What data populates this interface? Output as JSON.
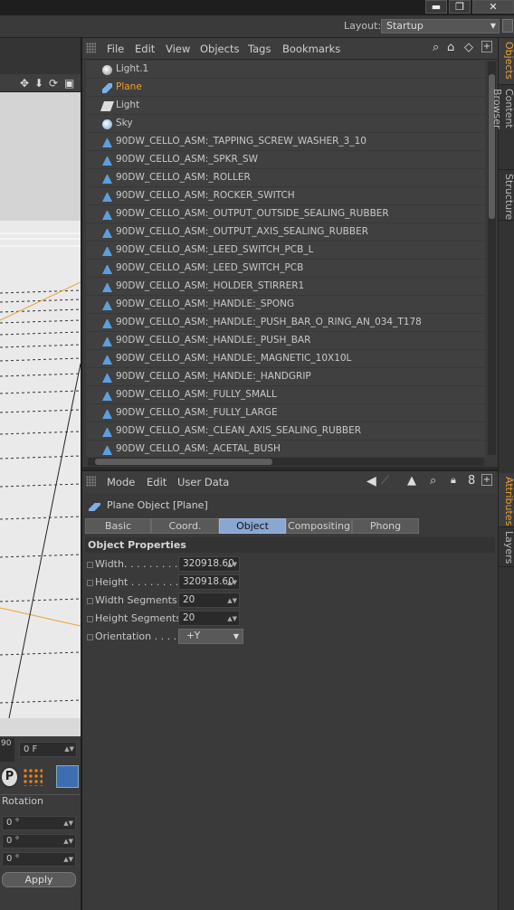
{
  "window": {
    "minimize": "▬",
    "restore": "❐",
    "close": "✕"
  },
  "layout": {
    "label": "Layout:",
    "value": "Startup"
  },
  "object_manager": {
    "menu": [
      "File",
      "Edit",
      "View",
      "Objects",
      "Tags",
      "Bookmarks"
    ],
    "objects": [
      {
        "name": "Light.1",
        "icon": "bulb-icon",
        "color": "#c9c9c9"
      },
      {
        "name": "Plane",
        "icon": "plane-icon",
        "color": "#f0a030"
      },
      {
        "name": "Light",
        "icon": "spotlight-icon",
        "color": "#c9c9c9"
      },
      {
        "name": "Sky",
        "icon": "sky-icon",
        "color": "#c9c9c9"
      },
      {
        "name": "90DW_CELLO_ASM:_TAPPING_SCREW_WASHER_3_10",
        "icon": "cone-icon",
        "color": "#c9c9c9"
      },
      {
        "name": "90DW_CELLO_ASM:_SPKR_SW",
        "icon": "cone-icon",
        "color": "#c9c9c9"
      },
      {
        "name": "90DW_CELLO_ASM:_ROLLER",
        "icon": "cone-icon",
        "color": "#c9c9c9"
      },
      {
        "name": "90DW_CELLO_ASM:_ROCKER_SWITCH",
        "icon": "cone-icon",
        "color": "#c9c9c9"
      },
      {
        "name": "90DW_CELLO_ASM:_OUTPUT_OUTSIDE_SEALING_RUBBER",
        "icon": "cone-icon",
        "color": "#c9c9c9"
      },
      {
        "name": "90DW_CELLO_ASM:_OUTPUT_AXIS_SEALING_RUBBER",
        "icon": "cone-icon",
        "color": "#c9c9c9"
      },
      {
        "name": "90DW_CELLO_ASM:_LEED_SWITCH_PCB_L",
        "icon": "cone-icon",
        "color": "#c9c9c9"
      },
      {
        "name": "90DW_CELLO_ASM:_LEED_SWITCH_PCB",
        "icon": "cone-icon",
        "color": "#c9c9c9"
      },
      {
        "name": "90DW_CELLO_ASM:_HOLDER_STIRRER1",
        "icon": "cone-icon",
        "color": "#c9c9c9"
      },
      {
        "name": "90DW_CELLO_ASM:_HANDLE:_SPONG",
        "icon": "cone-icon",
        "color": "#c9c9c9"
      },
      {
        "name": "90DW_CELLO_ASM:_HANDLE:_PUSH_BAR_O_RING_AN_034_T178",
        "icon": "cone-icon",
        "color": "#c9c9c9"
      },
      {
        "name": "90DW_CELLO_ASM:_HANDLE:_PUSH_BAR",
        "icon": "cone-icon",
        "color": "#c9c9c9"
      },
      {
        "name": "90DW_CELLO_ASM:_HANDLE:_MAGNETIC_10X10L",
        "icon": "cone-icon",
        "color": "#c9c9c9"
      },
      {
        "name": "90DW_CELLO_ASM:_HANDLE:_HANDGRIP",
        "icon": "cone-icon",
        "color": "#c9c9c9"
      },
      {
        "name": "90DW_CELLO_ASM:_FULLY_SMALL",
        "icon": "cone-icon",
        "color": "#c9c9c9"
      },
      {
        "name": "90DW_CELLO_ASM:_FULLY_LARGE",
        "icon": "cone-icon",
        "color": "#c9c9c9"
      },
      {
        "name": "90DW_CELLO_ASM:_CLEAN_AXIS_SEALING_RUBBER",
        "icon": "cone-icon",
        "color": "#c9c9c9"
      },
      {
        "name": "90DW_CELLO_ASM:_ACETAL_BUSH",
        "icon": "cone-icon",
        "color": "#c9c9c9"
      }
    ]
  },
  "attribute_manager": {
    "menu": [
      "Mode",
      "Edit",
      "User Data"
    ],
    "title": "Plane Object [Plane]",
    "tabs": [
      {
        "label": "Basic",
        "active": false
      },
      {
        "label": "Coord.",
        "active": false
      },
      {
        "label": "Object",
        "active": true
      },
      {
        "label": "Compositing",
        "active": false
      },
      {
        "label": "Phong",
        "active": false
      }
    ],
    "section": "Object Properties",
    "properties": [
      {
        "label": "Width. . . . . . . . . .",
        "value": "320918.60"
      },
      {
        "label": "Height . . . . . . . . .",
        "value": "320918.60"
      },
      {
        "label": "Width Segments",
        "value": "20"
      },
      {
        "label": "Height Segments",
        "value": "20"
      },
      {
        "label": "Orientation . . . . .",
        "value": "+Y"
      }
    ]
  },
  "side_tabs": {
    "top": [
      {
        "label": "Objects",
        "active": true
      },
      {
        "label": "Content Browser",
        "active": false
      },
      {
        "label": "Structure",
        "active": false
      }
    ],
    "bottom": [
      {
        "label": "Attributes",
        "active": true
      },
      {
        "label": "Layers",
        "active": false
      }
    ]
  },
  "left_panel": {
    "frame_small": "90",
    "frame_field": "0 F",
    "rotation_label": "Rotation",
    "rotation_values": [
      "0 °",
      "0 °",
      "0 °"
    ],
    "apply": "Apply"
  }
}
